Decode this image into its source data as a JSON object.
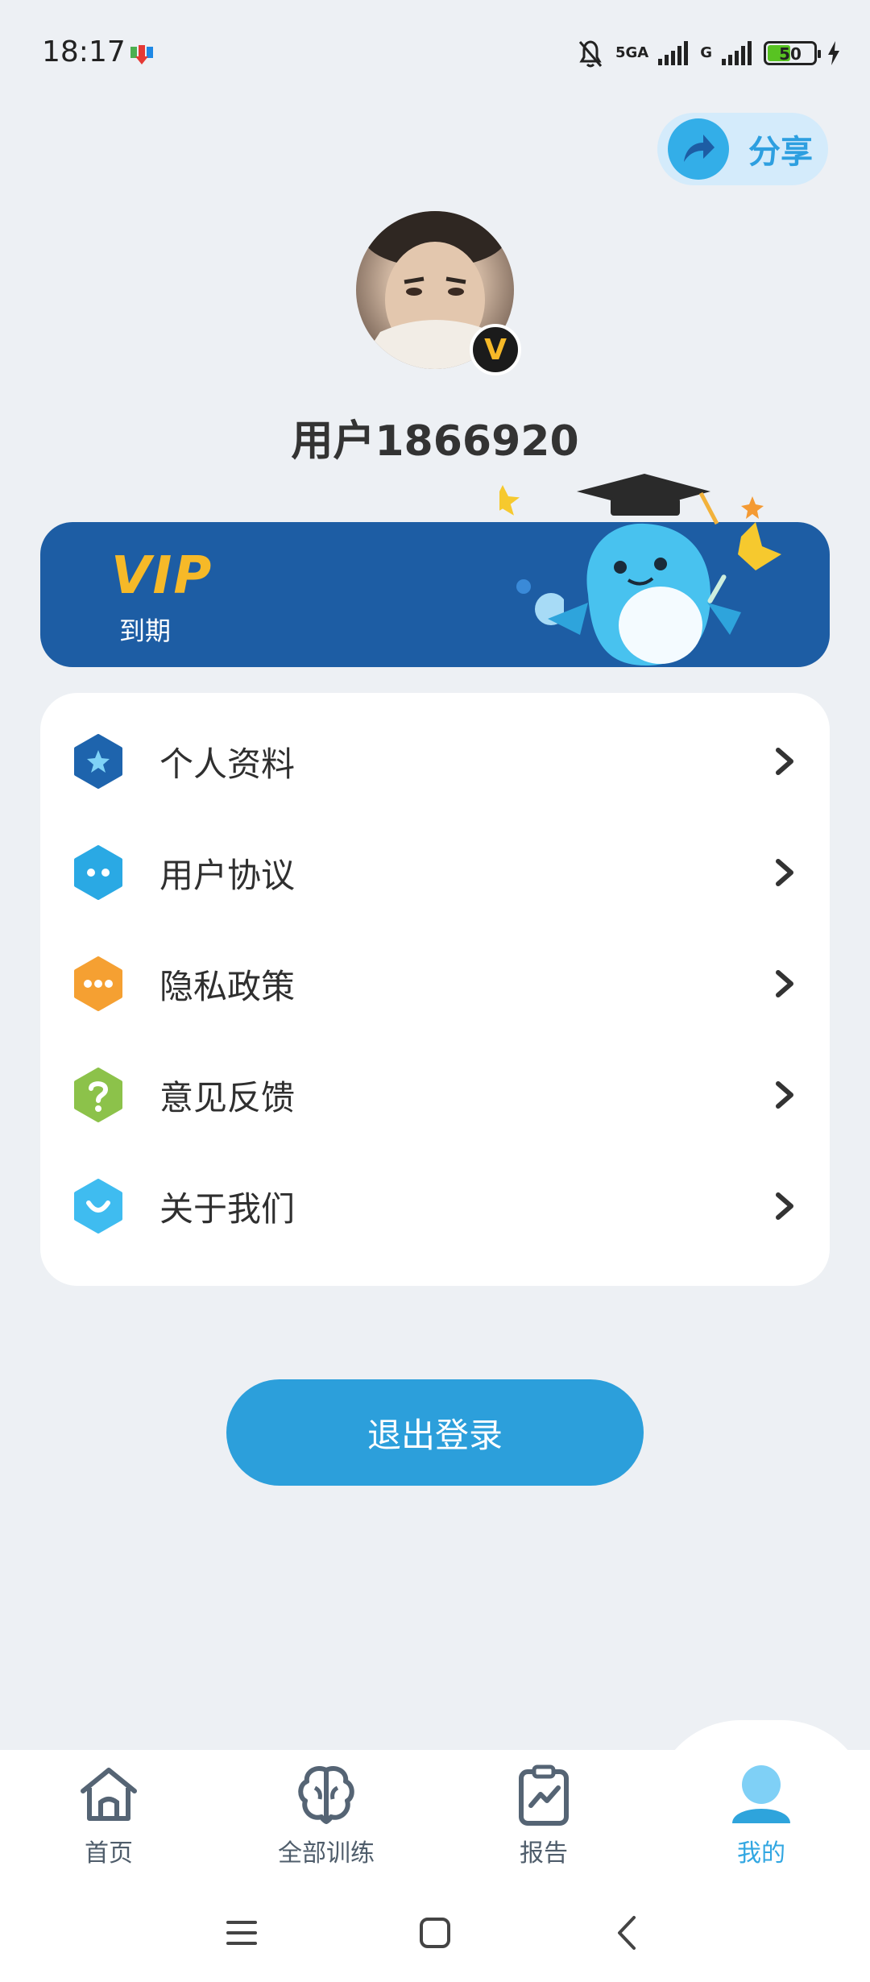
{
  "status_bar": {
    "time": "18:17",
    "network_1": "5GA",
    "network_2": "G",
    "battery": "50",
    "battery_fraction": 0.5
  },
  "share": {
    "label": "分享"
  },
  "profile": {
    "username": "用户1866920",
    "badge": "V"
  },
  "vip": {
    "logo": "VIP",
    "status": "到期"
  },
  "menu": {
    "items": [
      {
        "label": "个人资料",
        "icon": "star-hexagon-icon",
        "color": "#1e64ad"
      },
      {
        "label": "用户协议",
        "icon": "dots-hexagon-icon",
        "color": "#2aa9e4"
      },
      {
        "label": "隐私政策",
        "icon": "more-hexagon-icon",
        "color": "#f5a032"
      },
      {
        "label": "意见反馈",
        "icon": "question-hexagon-icon",
        "color": "#8cc24a"
      },
      {
        "label": "关于我们",
        "icon": "smile-hexagon-icon",
        "color": "#3fbcf0"
      }
    ]
  },
  "logout": {
    "label": "退出登录"
  },
  "bottom_nav": {
    "items": [
      {
        "label": "首页",
        "icon": "home-icon"
      },
      {
        "label": "全部训练",
        "icon": "brain-icon"
      },
      {
        "label": "报告",
        "icon": "report-clipboard-icon"
      },
      {
        "label": "我的",
        "icon": "profile-icon",
        "active": true
      }
    ]
  },
  "colors": {
    "primary": "#2c9fdb",
    "vip_banner": "#1d5da4",
    "vip_gold": "#f6b928",
    "background": "#edf0f4"
  }
}
